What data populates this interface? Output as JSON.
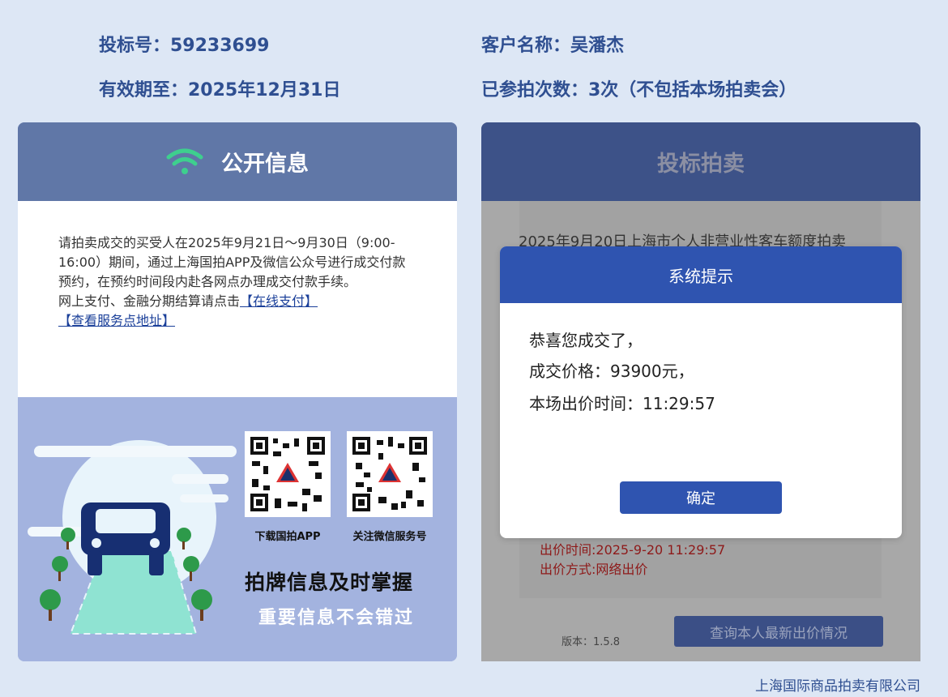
{
  "header": {
    "bid_number": "投标号：59233699",
    "client_name": "客户名称：吴潘杰",
    "valid_until": "有效期至：2025年12月31日",
    "participation": "已参拍次数：3次（不包括本场拍卖会）"
  },
  "left_panel": {
    "title": "公开信息",
    "icon": "wifi-icon",
    "notice_text": "请拍卖成交的买受人在2025年9月21日～9月30日（9:00-16:00）期间，通过上海国拍APP及微信公众号进行成交付款预约，在预约时间段内赴各网点办理成交付款手续。",
    "payment_text": "网上支付、金融分期结算请点击",
    "online_pay_link": "【在线支付】",
    "service_link": "【查看服务点地址】",
    "qr_app_caption": "下载国拍APP",
    "qr_wechat_caption": "关注微信服务号",
    "slogan_main": "拍牌信息及时掌握",
    "slogan_sub": "重要信息不会错过"
  },
  "right_panel": {
    "title": "投标拍卖",
    "auction_title": "2025年9月20日上海市个人非营业性客车额度拍卖",
    "bid_time": "出价时间:2025-9-20 11:29:57",
    "bid_method": "出价方式:网络出价",
    "version": "版本：1.5.8",
    "query_button": "查询本人最新出价情况"
  },
  "modal": {
    "title": "系统提示",
    "line1": "恭喜您成交了，",
    "line2": "成交价格：93900元，",
    "line3": "本场出价时间：11:29:57",
    "ok_button": "确定"
  },
  "footer": {
    "company": "上海国际商品拍卖有限公司"
  },
  "colors": {
    "background": "#dde7f5",
    "left_header": "#6077a7",
    "right_header": "#3d5288",
    "modal_accent": "#2f54b0",
    "wifi_icon": "#3ecf8e"
  }
}
